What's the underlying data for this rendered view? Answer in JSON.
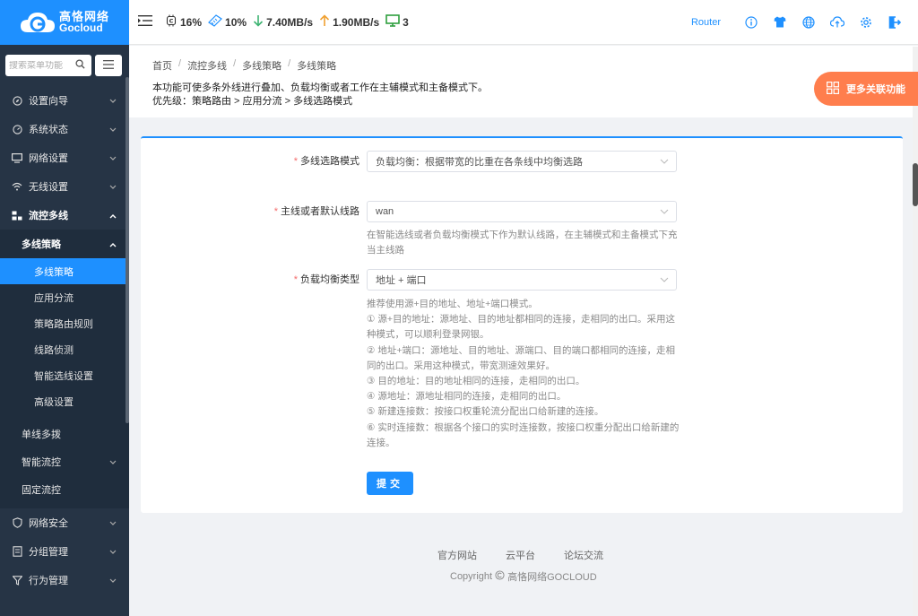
{
  "brand": {
    "name_cn": "高恪网络",
    "name_en": "Gocloud"
  },
  "search": {
    "placeholder": "搜索菜单功能"
  },
  "stats": {
    "cpu": "16%",
    "memory": "10%",
    "download": "7.40MB/s",
    "upload": "1.90MB/s",
    "devices": "3"
  },
  "topbar": {
    "router_label": "Router"
  },
  "sidebar": {
    "items": [
      {
        "label": "设置向导"
      },
      {
        "label": "系统状态"
      },
      {
        "label": "网络设置"
      },
      {
        "label": "无线设置"
      },
      {
        "label": "流控多线"
      }
    ],
    "submenu_title": "多线策略",
    "submenu_leaves": [
      "多线策略",
      "应用分流",
      "策略路由规则",
      "线路侦测",
      "智能选线设置",
      "高级设置"
    ],
    "siblings": [
      "单线多拨",
      "智能流控",
      "固定流控"
    ],
    "bottom_items": [
      {
        "label": "网络安全"
      },
      {
        "label": "分组管理"
      },
      {
        "label": "行为管理"
      }
    ]
  },
  "breadcrumb": [
    "首页",
    "流控多线",
    "多线策略",
    "多线策略"
  ],
  "description": {
    "line1": "本功能可使多条外线进行叠加、负载均衡或者工作在主辅模式和主备模式下。",
    "line2": "优先级：策略路由 > 应用分流 > 多线选路模式"
  },
  "more_button": "更多关联功能",
  "form": {
    "mode": {
      "label": "多线选路模式",
      "value": "负载均衡：根据带宽的比重在各条线中均衡选路"
    },
    "default_line": {
      "label": "主线或者默认线路",
      "value": "wan",
      "help": "在智能选线或者负载均衡模式下作为默认线路，在主辅模式和主备模式下充当主线路"
    },
    "balance_type": {
      "label": "负载均衡类型",
      "value": "地址 + 端口",
      "help": [
        "推荐使用源+目的地址、地址+端口模式。",
        "① 源+目的地址：源地址、目的地址都相同的连接，走相同的出口。采用这种模式，可以顺利登录网银。",
        "② 地址+端口：源地址、目的地址、源端口、目的端口都相同的连接，走相同的出口。采用这种模式，带宽测速效果好。",
        "③ 目的地址：目的地址相同的连接，走相同的出口。",
        "④ 源地址：源地址相同的连接，走相同的出口。",
        "⑤ 新建连接数：按接口权重轮流分配出口给新建的连接。",
        "⑥ 实时连接数：根据各个接口的实时连接数，按接口权重分配出口给新建的连接。"
      ]
    },
    "submit_label": "提交"
  },
  "footer": {
    "links": [
      "官方网站",
      "云平台",
      "论坛交流"
    ],
    "copyright": "Copyright",
    "company": "高恪网络GOCLOUD"
  },
  "colors": {
    "primary": "#1e90ff",
    "sidebar": "#263445",
    "accent": "#ff7e4d",
    "required": "#f56c6c"
  }
}
